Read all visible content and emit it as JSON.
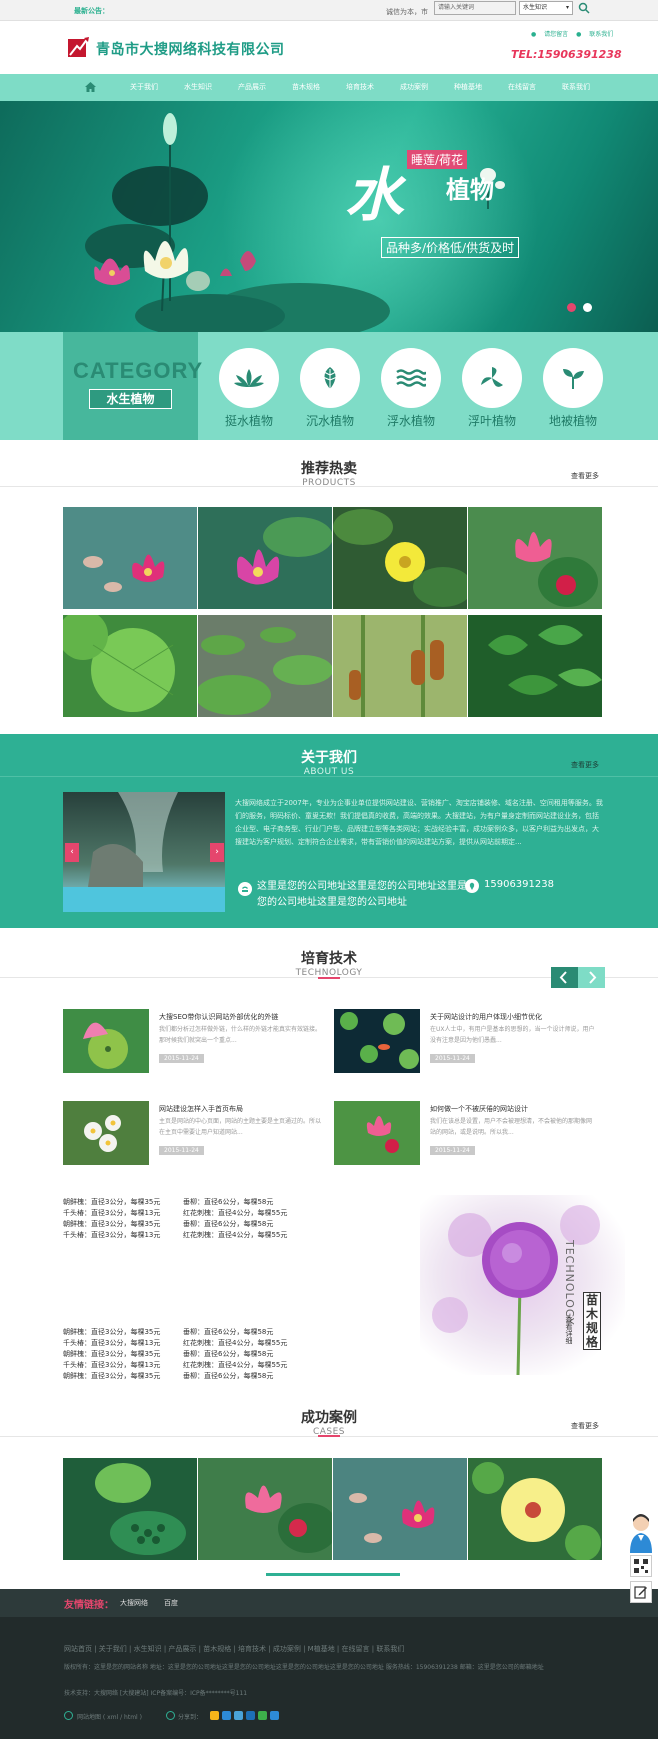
{
  "topbar": {
    "notice_label": "最新公告：",
    "slogan": "诚信为本，市",
    "search_placeholder": "请输入关键词",
    "search_category": "水生知识"
  },
  "header": {
    "company_name": "青岛市大搜网络科技有限公司",
    "link_message": "请您留言",
    "link_contact": "联系我们",
    "tel": "TEL:15906391238"
  },
  "nav": {
    "items": [
      "关于我们",
      "水生知识",
      "产品展示",
      "苗木规格",
      "培育技术",
      "成功案例",
      "种植基地",
      "在线留言",
      "联系我们"
    ]
  },
  "banner": {
    "big_char": "水",
    "tag": "睡莲/荷花",
    "plant": "植物",
    "sub": "品种多/价格低/供货及时"
  },
  "category": {
    "en": "CATEGORY",
    "cn": "水生植物",
    "items": [
      "挺水植物",
      "沉水植物",
      "浮水植物",
      "浮叶植物",
      "地被植物"
    ]
  },
  "products": {
    "cn": "推荐热卖",
    "en": "PRODUCTS",
    "more": "查看更多"
  },
  "about": {
    "cn": "关于我们",
    "en": "ABOUT US",
    "more": "查看更多",
    "text": "大搜网络成立于2007年，专业为企事业单位提供网站建设、营销推广、淘宝店铺装修、域名注册、空间租用等服务。我们的服务，明码标价、童叟无欺！我们提倡真的收费，高端的效果。大搜建站，为有户量身定制而网站建设业务，包括企业型、电子商务型、行业门户型、品牌建立型等各类网站；实战经验丰富，成功案例众多，以客户利益为出发点，大搜建站为客户规划、定制符合企业需求，带有营销价值的网站建站方案，提供从网站前期定...",
    "address": "这里是您的公司地址这里是您的公司地址这里是您的公司地址这里是您的公司地址",
    "phone": "15906391238"
  },
  "tech": {
    "cn": "培育技术",
    "en": "TECHNOLOGY",
    "articles": [
      {
        "title": "大搜SEO带你认识网站外部优化的外链",
        "desc": "我们都分析过怎样做外链，什么样的外链才能真实有效链接。那时候我们就突出一个重点...",
        "date": "2015-11-24"
      },
      {
        "title": "关于网站设计的用户体现小细节优化",
        "desc": "在UX人士中，有用户是基本的思想的，当一个设计师说，用户没有注意是因为他们愚蠢...",
        "date": "2015-11-24"
      },
      {
        "title": "网站建设怎样入手首页布局",
        "desc": "主页是网站的中心页面，网站的主题主要是主页通过的。所以在主页中需要让用户知道网站...",
        "date": "2015-11-24"
      },
      {
        "title": "如何做一个不被厌倦的网站设计",
        "desc": "我们在该总是设置，用户不会被理想清，不会被他的那期像网站的网站，或是说明。所以我...",
        "date": "2015-11-24"
      }
    ],
    "prices_top": [
      [
        "朝鲜槐：直径3公分，每棵35元",
        "垂柳：直径6公分，每棵58元"
      ],
      [
        "千头椿：直径3公分，每棵13元",
        "红花刺槐：直径4公分，每棵55元"
      ],
      [
        "朝鲜槐：直径3公分，每棵35元",
        "垂柳：直径6公分，每棵58元"
      ],
      [
        "千头椿：直径3公分，每棵13元",
        "红花刺槐：直径4公分，每棵55元"
      ]
    ],
    "prices_bottom": [
      [
        "朝鲜槐：直径3公分，每棵35元",
        "垂柳：直径6公分，每棵58元"
      ],
      [
        "千头椿：直径3公分，每棵13元",
        "红花刺槐：直径4公分，每棵55元"
      ],
      [
        "朝鲜槐：直径3公分，每棵35元",
        "垂柳：直径6公分，每棵58元"
      ],
      [
        "千头椿：直径3公分，每棵13元",
        "红花刺槐：直径4公分，每棵55元"
      ],
      [
        "朝鲜槐：直径3公分，每棵35元",
        "垂柳：直径6公分，每棵58元"
      ]
    ],
    "feature_cn": "苗木规格",
    "feature_en": "TECHNOLOGY",
    "feature_more": "查看详细"
  },
  "cases": {
    "cn": "成功案例",
    "en": "CASES",
    "more": "查看更多"
  },
  "footer": {
    "links_title": "友情链接：",
    "links": [
      "大搜网络",
      "百度"
    ],
    "nav": "网站首页 | 关于我们 | 水生知识 | 产品展示 | 苗木规格 | 培育技术 | 成功案例 | M植基地 | 在线留言 | 联系我们",
    "info": "版权所有：这里是您的网站名称    地址：这里是您的公司地址这里是您的公司地址这里是您的公司地址这里是您的公司地址    服务热线：15906391238    邮箱：这里是您公司的邮箱地址",
    "tech": "技术支持：大搜网络 [大搜建站]    ICP备案编号：ICP备********号111",
    "sitemap": "网站地图 ( xml / html )",
    "share": "分享到："
  },
  "colors": {
    "primary": "#2eb094",
    "nav": "#7edcc6",
    "accent": "#e5466d",
    "footer": "#222b2b"
  }
}
